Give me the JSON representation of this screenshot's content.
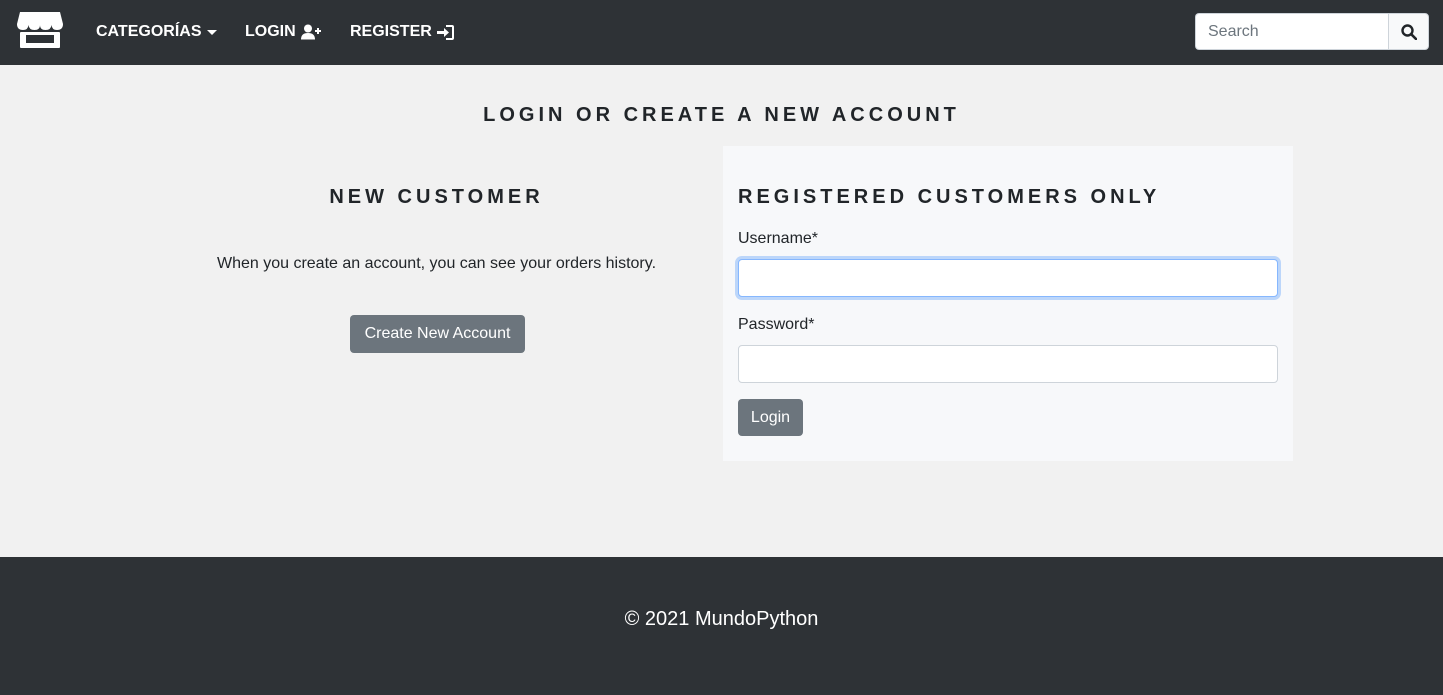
{
  "navbar": {
    "brand_icon": "store-icon",
    "categories_label": "CATEGORÍAS",
    "login_label": "LOGIN",
    "register_label": "REGISTER",
    "search_placeholder": "Search"
  },
  "main": {
    "title": "LOGIN OR CREATE A NEW ACCOUNT",
    "new_customer": {
      "title": "NEW CUSTOMER",
      "text": "When you create an account, you can see your orders history.",
      "button_label": "Create New Account"
    },
    "registered": {
      "title": "REGISTERED CUSTOMERS ONLY",
      "username_label": "Username*",
      "username_value": "",
      "password_label": "Password*",
      "password_value": "",
      "login_button_label": "Login"
    }
  },
  "footer": {
    "text": "© 2021 MundoPython"
  },
  "colors": {
    "navbar_bg": "#2e3236",
    "page_bg": "#f1f1f1",
    "panel_bg": "#f7f8fa",
    "button_bg": "#6c757d",
    "focus_border": "#86b7fe"
  }
}
